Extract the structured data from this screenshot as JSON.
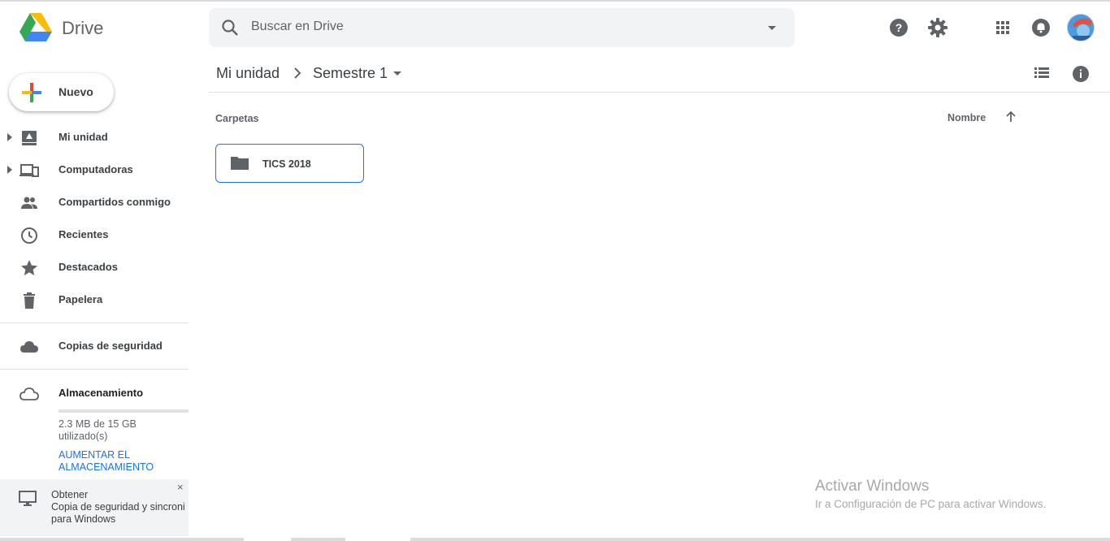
{
  "app": {
    "name": "Drive"
  },
  "search": {
    "placeholder": "Buscar en Drive"
  },
  "header_icons": [
    "help-icon",
    "settings-icon",
    "apps-grid-icon",
    "notifications-icon",
    "avatar"
  ],
  "new_button": {
    "label": "Nuevo"
  },
  "sidebar": {
    "items": [
      {
        "label": "Mi unidad",
        "icon": "my-drive-icon",
        "expandable": true
      },
      {
        "label": "Computadoras",
        "icon": "computers-icon",
        "expandable": true
      },
      {
        "label": "Compartidos conmigo",
        "icon": "shared-icon",
        "expandable": false
      },
      {
        "label": "Recientes",
        "icon": "clock-icon",
        "expandable": false
      },
      {
        "label": "Destacados",
        "icon": "star-icon",
        "expandable": false
      },
      {
        "label": "Papelera",
        "icon": "trash-icon",
        "expandable": false
      }
    ],
    "backups": {
      "label": "Copias de seguridad",
      "icon": "cloud-icon"
    },
    "storage": {
      "label": "Almacenamiento",
      "icon": "cloud-outline-icon",
      "usage_line1": "2.3 MB de 15 GB",
      "usage_line2": "utilizado(s)",
      "used_fraction": 0.00015,
      "upgrade_line1": "AUMENTAR EL",
      "upgrade_line2": "ALMACENAMIENTO"
    },
    "promo": {
      "line1": "Obtener",
      "line2": "Copia de seguridad y sincroni",
      "line3": "para Windows",
      "close": "×"
    }
  },
  "breadcrumb": {
    "root": "Mi unidad",
    "current": "Semestre 1"
  },
  "main": {
    "section_title": "Carpetas",
    "sort_label": "Nombre",
    "folders": [
      {
        "name": "TICS 2018"
      }
    ]
  },
  "watermark": {
    "title": "Activar Windows",
    "subtitle": "Ir a Configuración de PC para activar Windows."
  },
  "colors": {
    "accent": "#1a73e8",
    "icon_grey": "#5f6368",
    "search_bg": "#f1f3f4"
  }
}
